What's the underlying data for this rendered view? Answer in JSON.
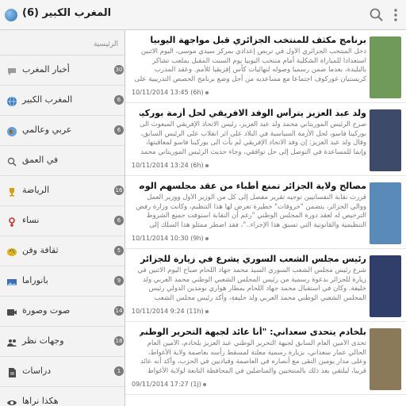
{
  "header": {
    "title": "المغرب الكبير (6)",
    "icons": [
      "app-globe-icon",
      "search-icon",
      "overflow-menu-icon"
    ]
  },
  "sidebar": {
    "section": "الرئيسية",
    "items": [
      {
        "label": "أخبار المغرب",
        "count": "30",
        "icon": "chat-bubble-icon",
        "color": "#9a9a9a"
      },
      {
        "label": "المغرب الكبير",
        "count": "6",
        "icon": "globe-icon",
        "color": "#3b7bc0"
      },
      {
        "label": "عربي وعالمي",
        "count": "6",
        "icon": "world-icon",
        "color": "#8a6a3a"
      },
      {
        "label": "في العمق",
        "count": "",
        "icon": "magnifier-icon",
        "color": "#666666"
      },
      {
        "label": "الرياضة",
        "count": "16",
        "icon": "trophy-icon",
        "color": "#d4a017"
      },
      {
        "label": "نساء",
        "count": "6",
        "icon": "female-icon",
        "color": "#d0302a"
      },
      {
        "label": "ثقافة وفن",
        "count": "5",
        "icon": "palette-icon",
        "color": "#e0b020"
      },
      {
        "label": "بانوراما",
        "count": "9",
        "icon": "panorama-icon",
        "color": "#3f6fb0"
      },
      {
        "label": "صوت وصورة",
        "count": "14",
        "icon": "media-icon",
        "color": "#4a4a4a"
      },
      {
        "label": "وجهات نظر",
        "count": "18",
        "icon": "people-icon",
        "color": "#4a4a4a"
      },
      {
        "label": "دراسات",
        "count": "1",
        "icon": "document-icon",
        "color": "#4a4a4a"
      },
      {
        "label": "هكذا نراها",
        "count": "",
        "icon": "eye-icon",
        "color": "#4a4a4a"
      }
    ]
  },
  "articles": [
    {
      "title": "برنامج مكثف للمنتخب الجزائري قبل مواجهة اليوبيا",
      "body": "دخل المنتخب الجزائري الأول في تربص إعدادي بمركز سيدي موسى، اليوم الاثنين استعدادا للمباراة الشكلية أمام منتخب اليوبيا يوم السبت المقبل بملعب تشاكر بالبليدة، بعدما ضمن رسميا وصوله لنهائيات كأس إفريقيا للأمم. وعقد المدرب كريستيان غوركوف اجتماعا مع مساعديه من أجل وضع برنامج الحصص التدريبية على",
      "time": "10/11/2014 13:45 (6h)",
      "thumb": "#6f9a5a"
    },
    {
      "title": "ولد عبد العزيز يترأس الوفد الافريقي لحل أزمة بوركينافاسو",
      "body": "صرح الرئيس الموريتاني محمد ولد عبد العزيز، رئيس الاتحاد الإفريقي المبعوث الى بوركينا فاسو، لحل الأزمة السياسية في البلاد على اثر انقلاب على الرئيس السابق، وقال ولد عبد العزيز: إن وفد الاتحاد الإفريقي لم يأت الى بوركينا فاسو لمعاقبتها، وإنما للمساعدة في التوصل إلى حل توافقي، وجاء حديث الرئيس الموريتاني محمد",
      "time": "10/11/2014 13:24 (6h)",
      "thumb": "#3d4a6a"
    },
    {
      "title": "مصالح ولاية الجزائر تمنع أطباء من عقد مجلسهم الوطني",
      "body": "قررت نقابة النفسانيين توجيه تقرير مفصل إلى كل من الوزير الأول ووزير العمل ووالي الجزائر، يتضمن \"خروقات\" خطيرة تعرض لها هذا التنظيم، وكانت وزارة رفض الترخيص له لعقد دورة المجلس الوطني \"رغم أن النقابة استوفت جميع الشروط التنظيمية والقانونية التي تسبق هذا الإجراء..\"، فقد اضطر ممثلو هذا السلك إلى",
      "time": "10/11/2014 10:30 (9h)",
      "thumb": "#5a8ab8"
    },
    {
      "title": "رئيس مجلس الشعب السوري يشرع في زيارة للجزائر",
      "body": "شرع رئيس مجلس الشعب السوري السيد محمد جهاد اللحام صباح اليوم الاثنين في زيارة للجزائر بدعوة رسمية من رئيس المجلس الشعبي الوطني محمد العربي ولد خليفة. وكان في استقبال محمد جهاد اللحام بمطار هواري بومدين الدولي رئيس المجلس الشعبي الوطني محمد العربي ولد خليفة، وأكد رئيس مجلس الشعب السوري",
      "time": "10/11/2014 9:24 (11h)",
      "thumb": "#2f3f6a"
    },
    {
      "title": "بلخادم يتحدى سعداني: \"أنا عائد لجبهة التحرير الوطني قريبا\"",
      "body": "تحدى الأمين العام السابق لجبهة التحرير الوطني عبد العزيز بلخادم، الأمين العام الحالي عمار سعداني، بزيارة رسمية معلنة لمسقط رأسه بعاصمة ولاية الأغواط، وعلى مدار يومين التقى مع أنصاره في العاصمة وقياديين في الحزب، وأكد أنه عائد قريبا، ليلتقي بعد ذلك بالمنتخبين والمناضلين في المحافظة التابعة لولاية الأغواط",
      "time": "09/11/2014 17:27 (1j)",
      "thumb": "#8a7a5a"
    }
  ]
}
